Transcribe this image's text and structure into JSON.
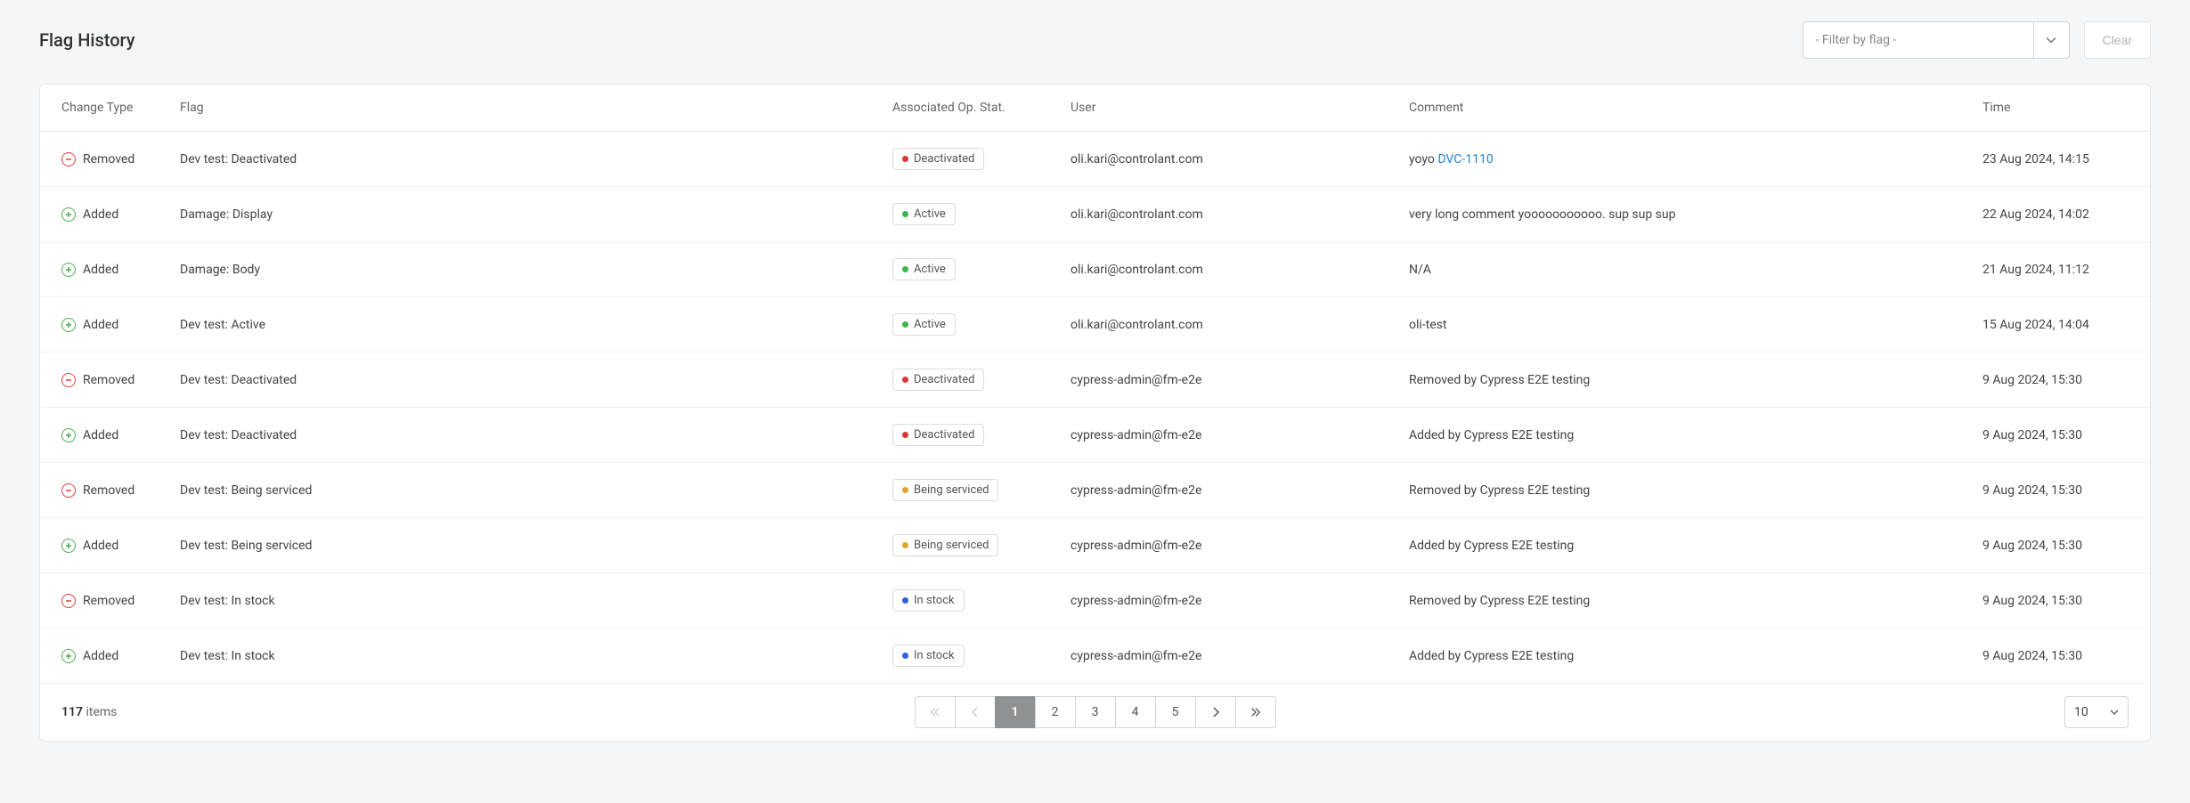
{
  "title": "Flag History",
  "filter": {
    "placeholder": "- Filter by flag -"
  },
  "clear_label": "Clear",
  "columns": {
    "change": "Change Type",
    "flag": "Flag",
    "status": "Associated Op. Stat.",
    "user": "User",
    "comment": "Comment",
    "time": "Time"
  },
  "change_labels": {
    "added": "Added",
    "removed": "Removed"
  },
  "status_labels": {
    "deactivated": "Deactivated",
    "active": "Active",
    "serviced": "Being serviced",
    "stock": "In stock"
  },
  "rows": [
    {
      "change": "removed",
      "flag": "Dev test: Deactivated",
      "status": "deactivated",
      "user": "oli.kari@controlant.com",
      "comment_text": "yoyo ",
      "comment_link": "DVC-1110",
      "time": "23 Aug 2024, 14:15"
    },
    {
      "change": "added",
      "flag": "Damage: Display",
      "status": "active",
      "user": "oli.kari@controlant.com",
      "comment_text": "very long comment yooooooooooo. sup sup sup",
      "comment_link": "",
      "time": "22 Aug 2024, 14:02"
    },
    {
      "change": "added",
      "flag": "Damage: Body",
      "status": "active",
      "user": "oli.kari@controlant.com",
      "comment_text": "N/A",
      "comment_link": "",
      "time": "21 Aug 2024, 11:12"
    },
    {
      "change": "added",
      "flag": "Dev test: Active",
      "status": "active",
      "user": "oli.kari@controlant.com",
      "comment_text": "oli-test",
      "comment_link": "",
      "time": "15 Aug 2024, 14:04"
    },
    {
      "change": "removed",
      "flag": "Dev test: Deactivated",
      "status": "deactivated",
      "user": "cypress-admin@fm-e2e",
      "comment_text": "Removed by Cypress E2E testing",
      "comment_link": "",
      "time": "9 Aug 2024, 15:30"
    },
    {
      "change": "added",
      "flag": "Dev test: Deactivated",
      "status": "deactivated",
      "user": "cypress-admin@fm-e2e",
      "comment_text": "Added by Cypress E2E testing",
      "comment_link": "",
      "time": "9 Aug 2024, 15:30"
    },
    {
      "change": "removed",
      "flag": "Dev test: Being serviced",
      "status": "serviced",
      "user": "cypress-admin@fm-e2e",
      "comment_text": "Removed by Cypress E2E testing",
      "comment_link": "",
      "time": "9 Aug 2024, 15:30"
    },
    {
      "change": "added",
      "flag": "Dev test: Being serviced",
      "status": "serviced",
      "user": "cypress-admin@fm-e2e",
      "comment_text": "Added by Cypress E2E testing",
      "comment_link": "",
      "time": "9 Aug 2024, 15:30"
    },
    {
      "change": "removed",
      "flag": "Dev test: In stock",
      "status": "stock",
      "user": "cypress-admin@fm-e2e",
      "comment_text": "Removed by Cypress E2E testing",
      "comment_link": "",
      "time": "9 Aug 2024, 15:30"
    },
    {
      "change": "added",
      "flag": "Dev test: In stock",
      "status": "stock",
      "user": "cypress-admin@fm-e2e",
      "comment_text": "Added by Cypress E2E testing",
      "comment_link": "",
      "time": "9 Aug 2024, 15:30"
    }
  ],
  "footer": {
    "total": "117",
    "items_word": "items",
    "pages": [
      "1",
      "2",
      "3",
      "4",
      "5"
    ],
    "active_page_index": 0,
    "page_size": "10"
  }
}
